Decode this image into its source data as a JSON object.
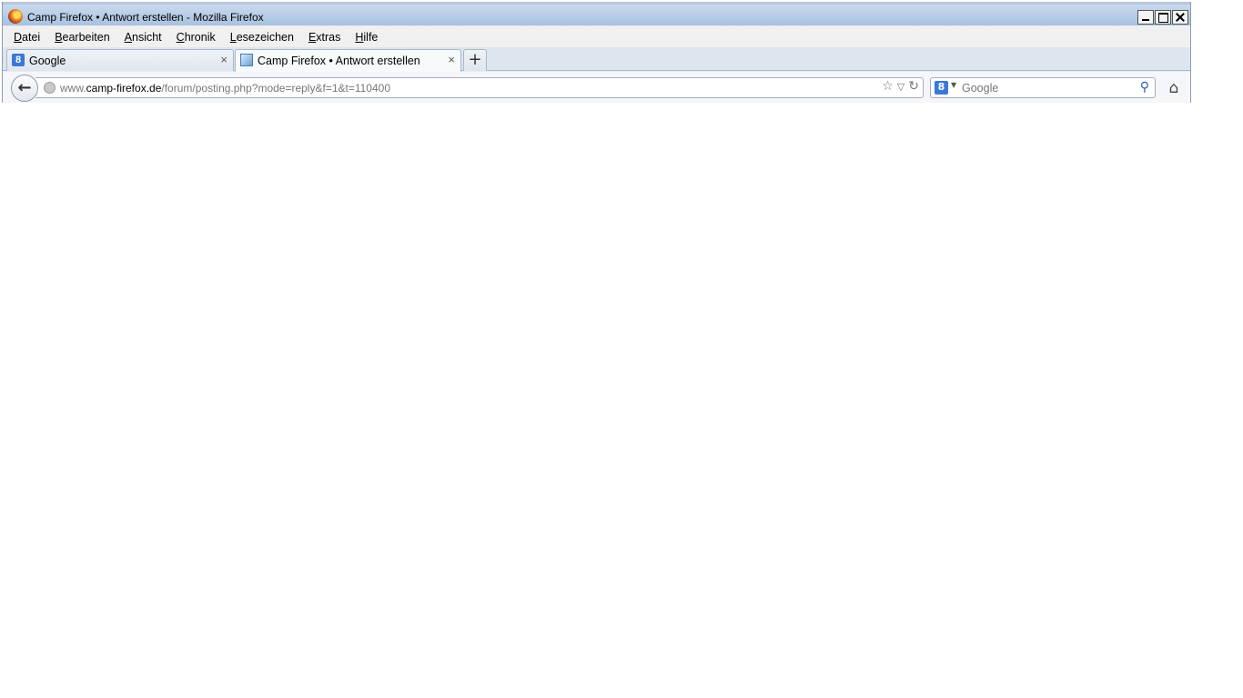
{
  "window": {
    "title": "Camp Firefox • Antwort erstellen - Mozilla Firefox"
  },
  "menu": [
    {
      "acc": "D",
      "rest": "atei"
    },
    {
      "acc": "B",
      "rest": "earbeiten"
    },
    {
      "acc": "A",
      "rest": "nsicht"
    },
    {
      "acc": "C",
      "rest": "hronik"
    },
    {
      "acc": "L",
      "rest": "esezeichen"
    },
    {
      "acc": "E",
      "rest": "xtras"
    },
    {
      "acc": "H",
      "rest": "ilfe"
    }
  ],
  "tabs": [
    {
      "label": "Google",
      "close": "×",
      "favicon": "google-g-icon"
    },
    {
      "label": "Camp Firefox • Antwort erstellen",
      "close": "×",
      "favicon": "camp-firefox-icon"
    }
  ],
  "newtab_label": "+",
  "urlbar": {
    "prefix": "www.",
    "domain": "camp-firefox.de",
    "path": "/forum/posting.php?mode=reply&f=1&t=110400"
  },
  "search": {
    "engine_letter": "8",
    "placeholder": "Google"
  },
  "icons": {
    "back": "←",
    "star": "☆",
    "dropdown": "▽",
    "reload": "↻",
    "search_go": "⚲",
    "home": "⌂"
  }
}
